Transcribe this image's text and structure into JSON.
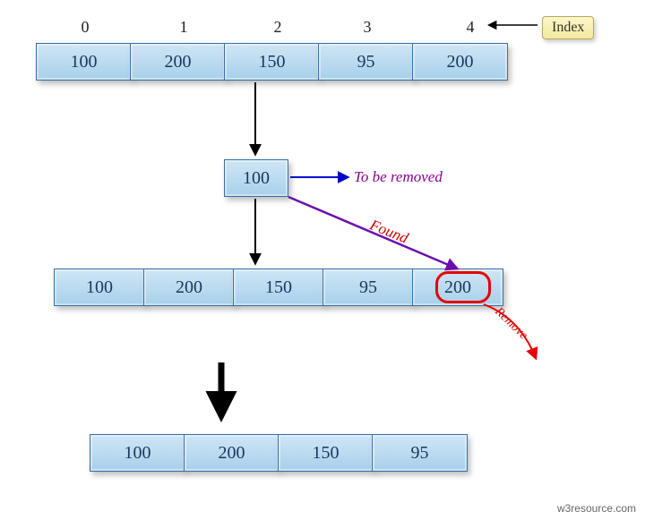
{
  "indices": [
    "0",
    "1",
    "2",
    "3",
    "4"
  ],
  "index_label": "Index",
  "array1": [
    "100",
    "200",
    "150",
    "95",
    "200"
  ],
  "removal_box": "100",
  "annot_remove_target": "To be removed",
  "annot_found": "Found",
  "annot_remove": "Remove",
  "array2": [
    "100",
    "200",
    "150",
    "95",
    "200"
  ],
  "array3": [
    "100",
    "200",
    "150",
    "95"
  ],
  "attribution": "w3resource.com"
}
